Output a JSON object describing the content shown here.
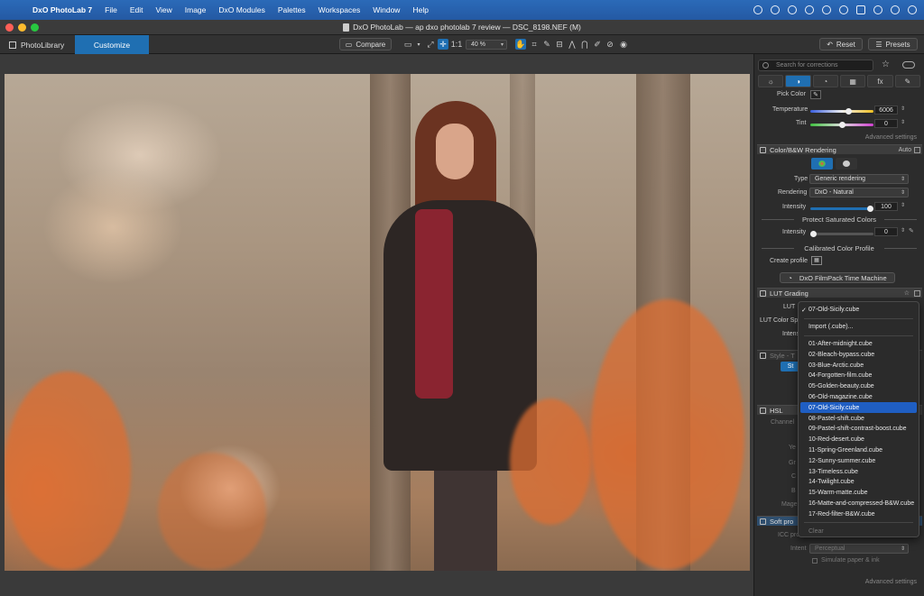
{
  "menubar": {
    "app_name": "DxO PhotoLab 7",
    "items": [
      "File",
      "Edit",
      "View",
      "Image",
      "DxO Modules",
      "Palettes",
      "Workspaces",
      "Window",
      "Help"
    ]
  },
  "window": {
    "title": "DxO PhotoLab — ap dxo photolab 7 review — DSC_8198.NEF (M)"
  },
  "toolbar": {
    "tab_library": "PhotoLibrary",
    "tab_customize": "Customize",
    "compare": "Compare",
    "zoom_fit": "1:1",
    "zoom": "40 %",
    "reset": "Reset",
    "presets": "Presets"
  },
  "panel": {
    "search_placeholder": "Search for corrections",
    "tabs": [
      "☼",
      "◑",
      "◔",
      "▦",
      "fx",
      "✎"
    ],
    "pick_color": "Pick Color",
    "temperature": {
      "label": "Temperature",
      "value": "6006",
      "level": 0.62
    },
    "tint": {
      "label": "Tint",
      "value": "0",
      "level": 0.5
    },
    "advanced_settings": "Advanced settings",
    "color_bw": {
      "title": "Color/B&W Rendering",
      "mode": "Auto",
      "type_label": "Type",
      "type_value": "Generic rendering",
      "rendering_label": "Rendering",
      "rendering_value": "DxO - Natural",
      "intensity_label": "Intensity",
      "intensity_value": "100",
      "intensity_level": 1.0
    },
    "protect": {
      "title": "Protect Saturated Colors",
      "intensity_label": "Intensity",
      "intensity_value": "0",
      "intensity_level": 0.0
    },
    "calibrated": {
      "title": "Calibrated Color Profile",
      "create_profile": "Create profile"
    },
    "filmpack_button": "DxO FilmPack Time Machine",
    "lut": {
      "title": "LUT Grading",
      "lut_label": "LUT",
      "colorspace_label": "LUT Color Sp",
      "intensity_label": "Intens"
    },
    "style_section": "Style - T",
    "style_btn": "St",
    "hsl_title": "HSL",
    "channel_label": "Channel",
    "hidden_labels": [
      "Ye",
      "Gr",
      "C",
      "B",
      "Mage"
    ],
    "soft_proof": "Soft pro",
    "icc_label": "ICC pro",
    "intent_label": "Intent",
    "intent_value": "Perceptual",
    "simulate": "Simulate paper & ink",
    "advanced_settings_2": "Advanced settings"
  },
  "lut_dropdown": {
    "current": "07-Old-Sicily.cube",
    "import": "Import (.cube)...",
    "items": [
      "01-After-midnight.cube",
      "02-Bleach-bypass.cube",
      "03-Blue-Arctic.cube",
      "04-Forgotten-film.cube",
      "05-Golden-beauty.cube",
      "06-Old-magazine.cube",
      "07-Old-Sicily.cube",
      "08-Pastel-shift.cube",
      "09-Pastel-shift-contrast-boost.cube",
      "10-Red-desert.cube",
      "11-Spring-Greenland.cube",
      "12-Sunny-summer.cube",
      "13-Timeless.cube",
      "14-Twilight.cube",
      "15-Warm-matte.cube",
      "16-Matte-and-compressed-B&W.cube",
      "17-Red-filter-B&W.cube"
    ],
    "selected_index": 6,
    "clear": "Clear"
  }
}
